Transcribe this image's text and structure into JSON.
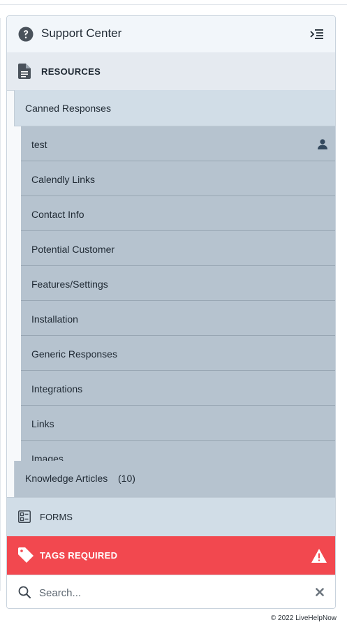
{
  "header": {
    "title": "Support Center",
    "help_icon": "question-circle-icon",
    "collapse_icon": "indent-collapse-icon"
  },
  "resources": {
    "label": "RESOURCES",
    "icon": "document-icon"
  },
  "canned_responses": {
    "label": "Canned Responses",
    "items": [
      {
        "label": "test",
        "icon": "user-icon"
      },
      {
        "label": "Calendly Links"
      },
      {
        "label": "Contact Info"
      },
      {
        "label": "Potential Customer"
      },
      {
        "label": "Features/Settings"
      },
      {
        "label": "Installation"
      },
      {
        "label": "Generic Responses"
      },
      {
        "label": "Integrations"
      },
      {
        "label": "Links"
      },
      {
        "label": "Images"
      }
    ]
  },
  "knowledge_articles": {
    "label": "Knowledge Articles",
    "count": "(10)"
  },
  "forms": {
    "label": "FORMS",
    "icon": "form-list-icon"
  },
  "tags": {
    "label": "TAGS REQUIRED",
    "icon": "tag-icon",
    "warning_icon": "warning-triangle-icon",
    "background": "#f2484f"
  },
  "search": {
    "placeholder": "Search...",
    "value": "",
    "icon": "search-icon",
    "clear_icon": "close-x-icon"
  },
  "footer": {
    "copyright": "© 2022 LiveHelpNow"
  }
}
